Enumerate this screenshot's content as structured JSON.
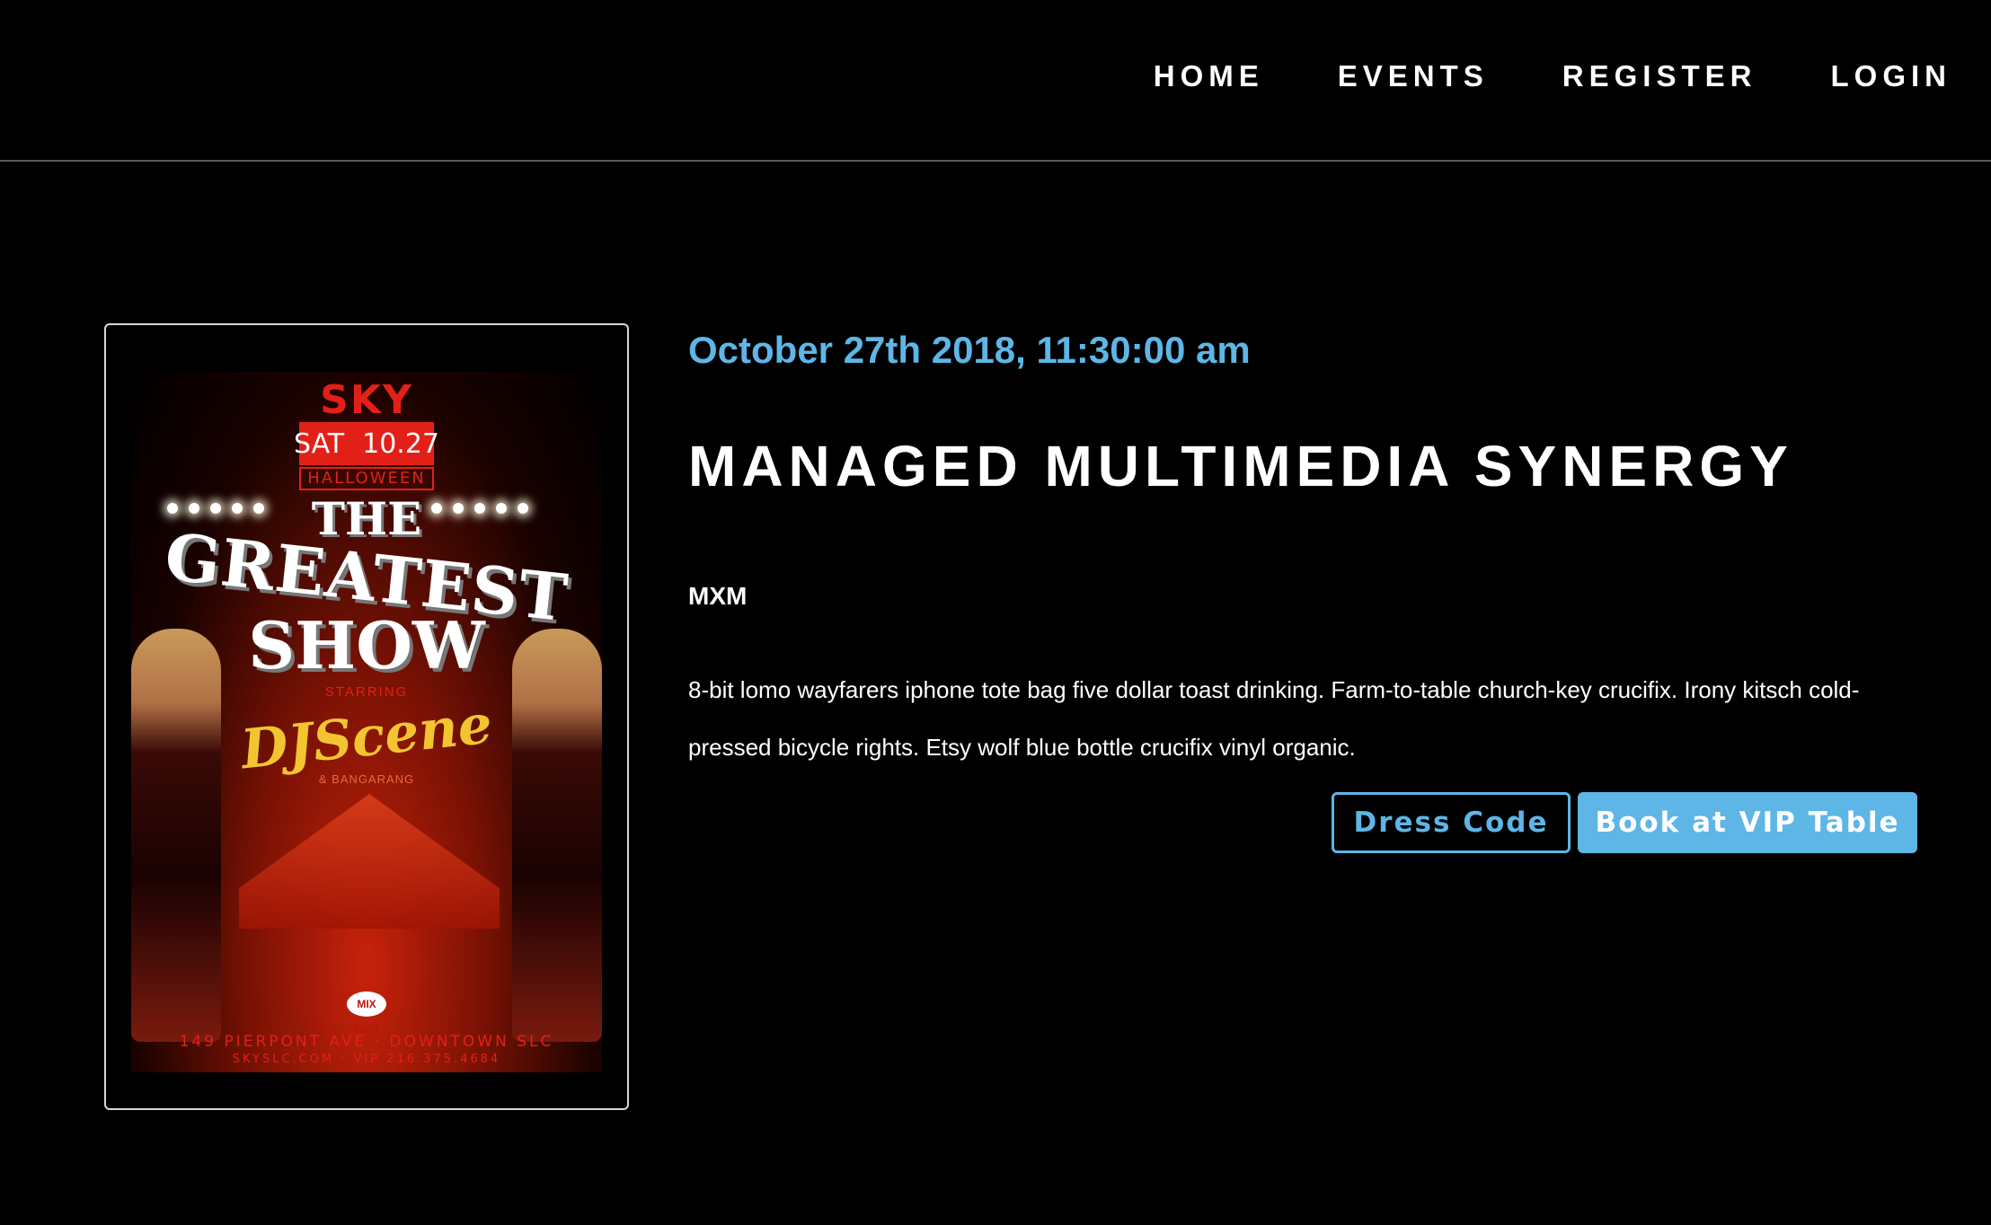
{
  "nav": {
    "items": [
      {
        "label": "HOME"
      },
      {
        "label": "EVENTS"
      },
      {
        "label": "REGISTER"
      },
      {
        "label": "LOGIN"
      }
    ]
  },
  "poster": {
    "brand": "SKY",
    "day": "SAT",
    "date": "10.27",
    "occasion": "HALLOWEEN",
    "title_line1": "THE",
    "title_line2": "GREATEST",
    "title_line3": "SHOW",
    "starring": "STARRING",
    "headliner": "DJScene",
    "support": "& BANGARANG",
    "sponsor": "MIX 105.1",
    "address": "149 PIERPONT AVE · DOWNTOWN SLC",
    "contact": "SKYSLC.COM · VIP 216.375.4684"
  },
  "event": {
    "datetime": "October 27th 2018, 11:30:00 am",
    "title": "MANAGED MULTIMEDIA SYNERGY",
    "organizer": "MXM",
    "description": "8-bit lomo wayfarers iphone tote bag five dollar toast drinking. Farm-to-table church-key crucifix. Irony kitsch cold-pressed bicycle rights. Etsy wolf blue bottle crucifix vinyl organic."
  },
  "actions": {
    "dress_code_label": "Dress Code",
    "vip_label": "Book at VIP Table"
  },
  "colors": {
    "accent": "#5db6e6",
    "background": "#000000",
    "poster_red": "#e32018",
    "poster_gold": "#f2c530"
  }
}
